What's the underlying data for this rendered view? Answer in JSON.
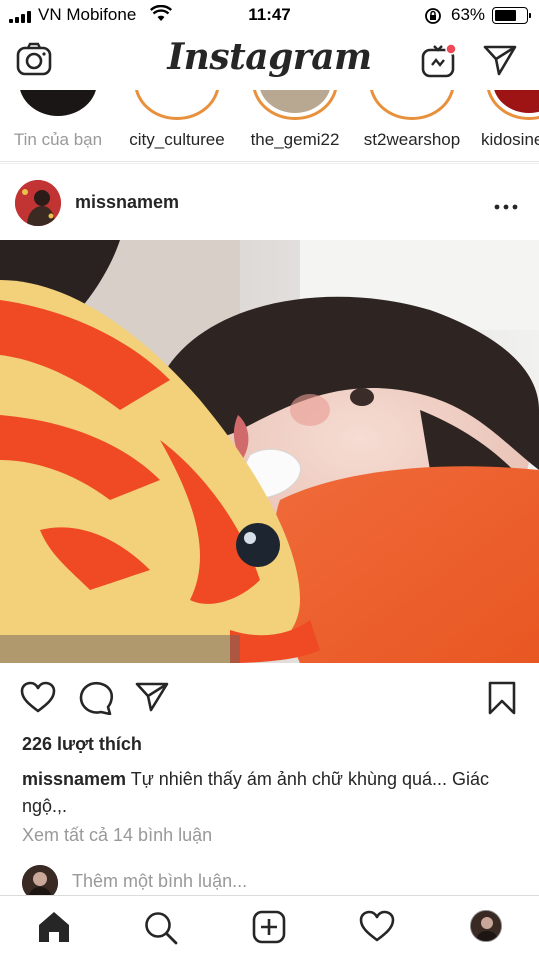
{
  "status_bar": {
    "carrier": "VN Mobifone",
    "time": "11:47",
    "battery_percent": "63%",
    "battery_level": 0.63
  },
  "header": {
    "logo": "Instagram",
    "camera_icon": "camera-icon",
    "igtv_icon": "igtv-icon",
    "direct_icon": "paper-plane-icon"
  },
  "stories": [
    {
      "name": "Tin của bạn",
      "own": true
    },
    {
      "name": "city_culturee"
    },
    {
      "name": "the_gemi22"
    },
    {
      "name": "st2wearshop"
    },
    {
      "name": "kidosine"
    }
  ],
  "post": {
    "username": "missnamem",
    "more_icon": "more-dots-icon",
    "likes": "226 lượt thích",
    "caption_user": "missnamem",
    "caption_text": " Tự nhiên thấy ám ảnh chữ khùng quá... Giác ngộ.,.",
    "view_comments": "Xem tất cả 14 bình luận",
    "comment_placeholder": "Thêm một bình luận..."
  },
  "tab_bar": {
    "icons": [
      "home-icon",
      "search-icon",
      "add-post-icon",
      "activity-heart-icon",
      "profile-avatar"
    ]
  },
  "colors": {
    "story_ring": "#e8903c",
    "notification_dot": "#ed4956",
    "text_primary": "#262626",
    "text_secondary": "#999999"
  }
}
